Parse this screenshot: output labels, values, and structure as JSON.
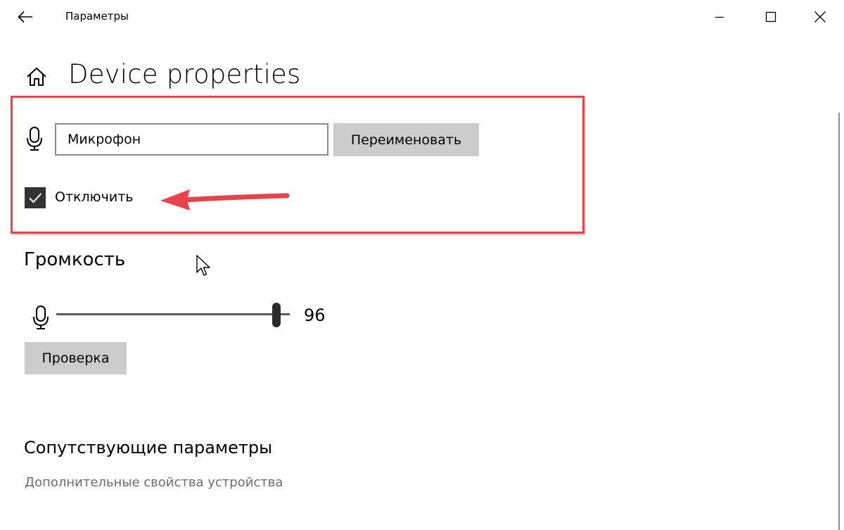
{
  "window": {
    "title": "Параметры",
    "back_icon": "arrow-left-icon",
    "minimize_icon": "minimize-icon",
    "maximize_icon": "maximize-icon",
    "close_icon": "close-icon"
  },
  "header": {
    "home_icon": "home-icon",
    "title": "Device properties"
  },
  "device": {
    "icon": "microphone-icon",
    "name_value": "Микрофон",
    "rename_label": "Переименовать",
    "disable_label": "Отключить",
    "disable_checked": true
  },
  "annotation": {
    "highlight_color": "#e8424d",
    "arrow_color": "#e8424d"
  },
  "volume": {
    "heading": "Громкость",
    "icon": "microphone-icon",
    "value": "96",
    "level_percent": 96,
    "test_label": "Проверка"
  },
  "related": {
    "heading": "Сопутствующие параметры",
    "link": "Дополнительные свойства устройства"
  }
}
